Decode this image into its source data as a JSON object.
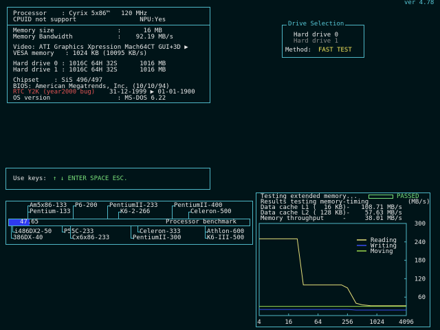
{
  "version": "ver 4.78",
  "sysinfo": {
    "processor_line": "Processor    : Cyrix 5x86™   120 MHz",
    "cpuid_line": "CPUID not support                 NPU:Yes",
    "memory_size_line": "Memory size                 :      16 MB",
    "memory_bw_line": "Memory Bandwidth            :    92.19 MB/s",
    "video_line": "Video: ATI Graphics Xpression Mach64CT GUI+3D ▶",
    "vesa_line": "VESA memory   : 1024 KB (10095 KB/s)",
    "hd0_line": "Hard drive 0 : 1016C 64H 32S      1016 MB",
    "hd1_line": "Hard drive 1 : 1016C 64H 32S      1016 MB",
    "chipset_line": "Chipset    : SiS 496/497",
    "bios_line": "BIOS: American Megatrends, Inc. (10/10/94)",
    "y2k_label": "RTC Y2K (year2000 bug)",
    "y2k_value": "31-12-1999 ▶ 01-01-1900",
    "os_line": "OS version                  : MS-DOS 6.22"
  },
  "drive_selection": {
    "title": "Drive Selection",
    "drives": [
      "Hard drive 0",
      "Hard drive 1"
    ],
    "method_label": "Method:",
    "method_value": "FAST TEST"
  },
  "keys": {
    "prefix": "Use keys:",
    "keys": "↑ ↓ ENTER SPACE ESC."
  },
  "benchmark": {
    "score": "47.65",
    "score_fraction": 0.087,
    "label": "Processor benchmark",
    "top_labels": [
      {
        "name": "Am5x86-133",
        "row": 0
      },
      {
        "name": "P6-200",
        "row": 0
      },
      {
        "name": "PentiumII-233",
        "row": 0
      },
      {
        "name": "PentiumII-400",
        "row": 0
      },
      {
        "name": "Pentium-133",
        "row": 1
      },
      {
        "name": "K6-2-266",
        "row": 1
      },
      {
        "name": "Celeron-500",
        "row": 1
      }
    ],
    "bottom_labels": [
      {
        "name": "i486DX2-50",
        "row": 0
      },
      {
        "name": "P55C-233",
        "row": 0
      },
      {
        "name": "Celeron-333",
        "row": 0
      },
      {
        "name": "Athlon-600",
        "row": 0
      },
      {
        "name": "386DX-40",
        "row": 1
      },
      {
        "name": "Cx6x86-233",
        "row": 1
      },
      {
        "name": "PentiumII-300",
        "row": 1
      },
      {
        "name": "K6-III-500",
        "row": 1
      }
    ]
  },
  "memtest": {
    "testing_line": "Testing extended memory...",
    "status": "PASSED",
    "header": "Results testing memory-timing",
    "unit": "(MB/s)",
    "l1_line": "Data cache L1 (  16 KB)-   108.71 MB/s",
    "l2_line": "Data cache L2 ( 128 KB)-    57.63 MB/s",
    "throughput_line": "Memory throughput     -     38.01 MB/s"
  },
  "chart_data": {
    "type": "line",
    "xlabel": "",
    "ylabel": "",
    "x": [
      4,
      8,
      16,
      24,
      32,
      48,
      64,
      96,
      128,
      192,
      256,
      384,
      512,
      768,
      1024,
      2048,
      4096
    ],
    "x_ticks": [
      "4",
      "16",
      "64",
      "256",
      "1024",
      "4096"
    ],
    "y_ticks": [
      "300",
      "240",
      "180",
      "120",
      "60"
    ],
    "ylim": [
      0,
      300
    ],
    "xscale": "log2",
    "legend": [
      "Reading",
      "Writing",
      "Moving"
    ],
    "legend_position": "top-right",
    "colors": {
      "Reading": "#e6e07a",
      "Writing": "#3a4df0",
      "Moving": "#9ad84e"
    },
    "series": [
      {
        "name": "Reading",
        "values": [
          250,
          250,
          250,
          250,
          100,
          100,
          100,
          100,
          100,
          100,
          90,
          40,
          35,
          32,
          32,
          32,
          32
        ]
      },
      {
        "name": "Writing",
        "values": [
          20,
          20,
          20,
          20,
          20,
          20,
          20,
          20,
          20,
          20,
          20,
          18,
          18,
          18,
          18,
          18,
          18
        ]
      },
      {
        "name": "Moving",
        "values": [
          30,
          30,
          30,
          30,
          30,
          30,
          30,
          30,
          30,
          30,
          30,
          30,
          30,
          30,
          30,
          30,
          30
        ]
      }
    ]
  }
}
